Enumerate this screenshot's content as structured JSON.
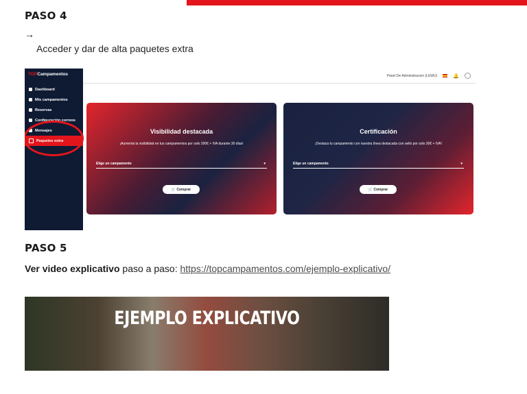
{
  "step4": {
    "heading": "PASO 4",
    "arrow": "→",
    "description": "Acceder y dar de alta paquetes extra"
  },
  "app": {
    "logo_prefix": "TOP",
    "logo_rest": "Campamentos",
    "sidebar_items": [
      {
        "label": "Dashboard",
        "icon": "dashboard-icon"
      },
      {
        "label": "Mis campamentos",
        "icon": "tent-icon"
      },
      {
        "label": "Reservas",
        "icon": "calendar-icon"
      },
      {
        "label": "Configuración correos",
        "icon": "mail-icon"
      },
      {
        "label": "Mensajes",
        "icon": "message-icon"
      },
      {
        "label": "Paquetes extra",
        "icon": "cart-icon",
        "active": true
      }
    ],
    "header_text": "Panel De Administracion (LEWU)",
    "cards": [
      {
        "title": "Visibilidad destacada",
        "description": "¡Aumenta la visibilidad en tus campamentos por solo 200€ + IVA durante 30 días!",
        "select_placeholder": "Elige un campamento",
        "button": "Comprar"
      },
      {
        "title": "Certificación",
        "description": "¡Destaca tu campamento con nuestra línea destacada con sello por solo 30€ + IVA!",
        "select_placeholder": "Elige un campamento",
        "button": "Comprar"
      }
    ],
    "accent_color": "#e3151c",
    "sidebar_color": "#0f1a33"
  },
  "step5": {
    "heading": "PASO 5",
    "bold_text": "Ver video explicativo",
    "text": " paso a paso: ",
    "link": "https://topcampamentos.com/ejemplo-explicativo/"
  },
  "video": {
    "title": "EJEMPLO EXPLICATIVO"
  }
}
